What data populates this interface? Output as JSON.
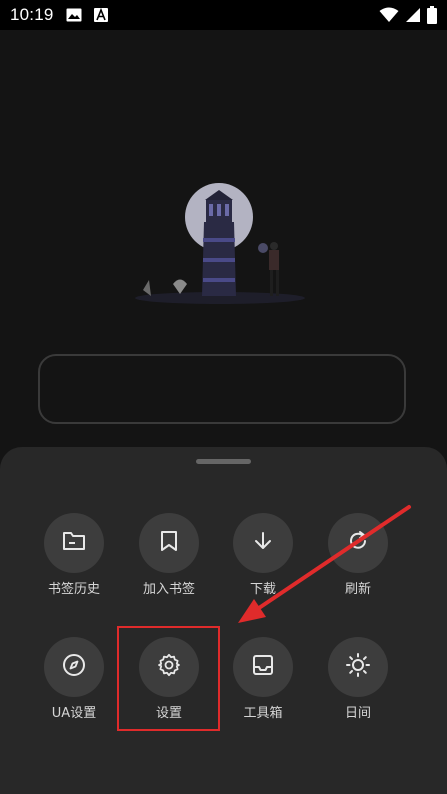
{
  "status_bar": {
    "time": "10:19",
    "left_icons": [
      "image-icon",
      "a-badge-icon"
    ],
    "right_icons": [
      "wifi-icon",
      "signal-icon",
      "battery-icon"
    ]
  },
  "main": {
    "illustration": "lighthouse-illustration",
    "search_placeholder": ""
  },
  "menu": {
    "row1": [
      {
        "label": "书签历史",
        "icon": "folder-icon"
      },
      {
        "label": "加入书签",
        "icon": "bookmark-icon"
      },
      {
        "label": "下载",
        "icon": "download-arrow-icon"
      },
      {
        "label": "刷新",
        "icon": "refresh-icon"
      }
    ],
    "row2": [
      {
        "label": "UA设置",
        "icon": "compass-icon"
      },
      {
        "label": "设置",
        "icon": "gear-icon"
      },
      {
        "label": "工具箱",
        "icon": "inbox-tray-icon"
      },
      {
        "label": "日间",
        "icon": "sun-icon"
      }
    ]
  },
  "annotation": {
    "highlight_color": "#e02b2b",
    "highlighted_item": "设置"
  },
  "colors": {
    "background": "#141414",
    "sheet": "#282828",
    "button_circle": "#3d3d3d",
    "accent_red": "#e02b2b"
  }
}
